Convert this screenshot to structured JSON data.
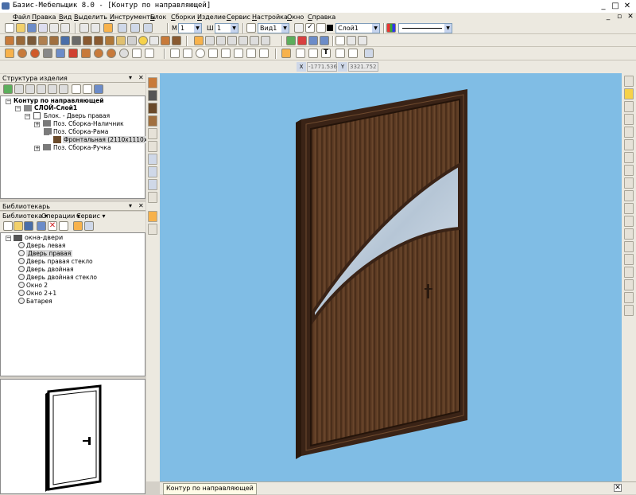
{
  "window": {
    "title": "Базис-Мебельщик 8.0 - [Контур по направляющей]"
  },
  "menu": [
    "Файл",
    "Правка",
    "Вид",
    "Выделить",
    "Инструменты",
    "Блок",
    "Сборки",
    "Изделие",
    "Сервис",
    "Настройка",
    "Окно",
    "Справка"
  ],
  "toolbar": {
    "m_label": "М",
    "m_value": "1",
    "sh_label": "Ш",
    "sh_value": "1",
    "view_value": "Вид1",
    "layer_value": "Слой1"
  },
  "coords": {
    "x": "-1771.536",
    "y": "3321.752"
  },
  "structure_panel": {
    "title": "Структура изделия",
    "items": [
      {
        "label": "Контур по направляющей",
        "bold": true
      },
      {
        "label": "СЛОЙ-Слой1",
        "bold": true
      },
      {
        "label": "Блок. - Дверь правая"
      },
      {
        "label": "Поз. Сборка-Наличник"
      },
      {
        "label": "Поз. Сборка-Рама"
      },
      {
        "label": "Фронтальная (2110x1110x30)"
      },
      {
        "label": "Поз. Сборка-Ручка"
      }
    ]
  },
  "library_panel": {
    "title": "Библиотекарь",
    "menu": {
      "library": "Библиотека ▾",
      "operations": "Операции ▾",
      "service": "Сервис ▾"
    },
    "root": "окна-двери",
    "items": [
      "Дверь левая",
      "Дверь правая",
      "Дверь правая стекло",
      "Дверь двойная",
      "Дверь двойная стекло",
      "Окно 2",
      "Окно 2+1",
      "Батарея"
    ],
    "selected": "Дверь правая"
  },
  "status": {
    "tab": "Контур по направляющей"
  },
  "colors": {
    "viewport_bg": "#80bde5",
    "wood_dark": "#3a2316",
    "wood_mid": "#5e3c24",
    "glass": "#c8d4e0"
  }
}
